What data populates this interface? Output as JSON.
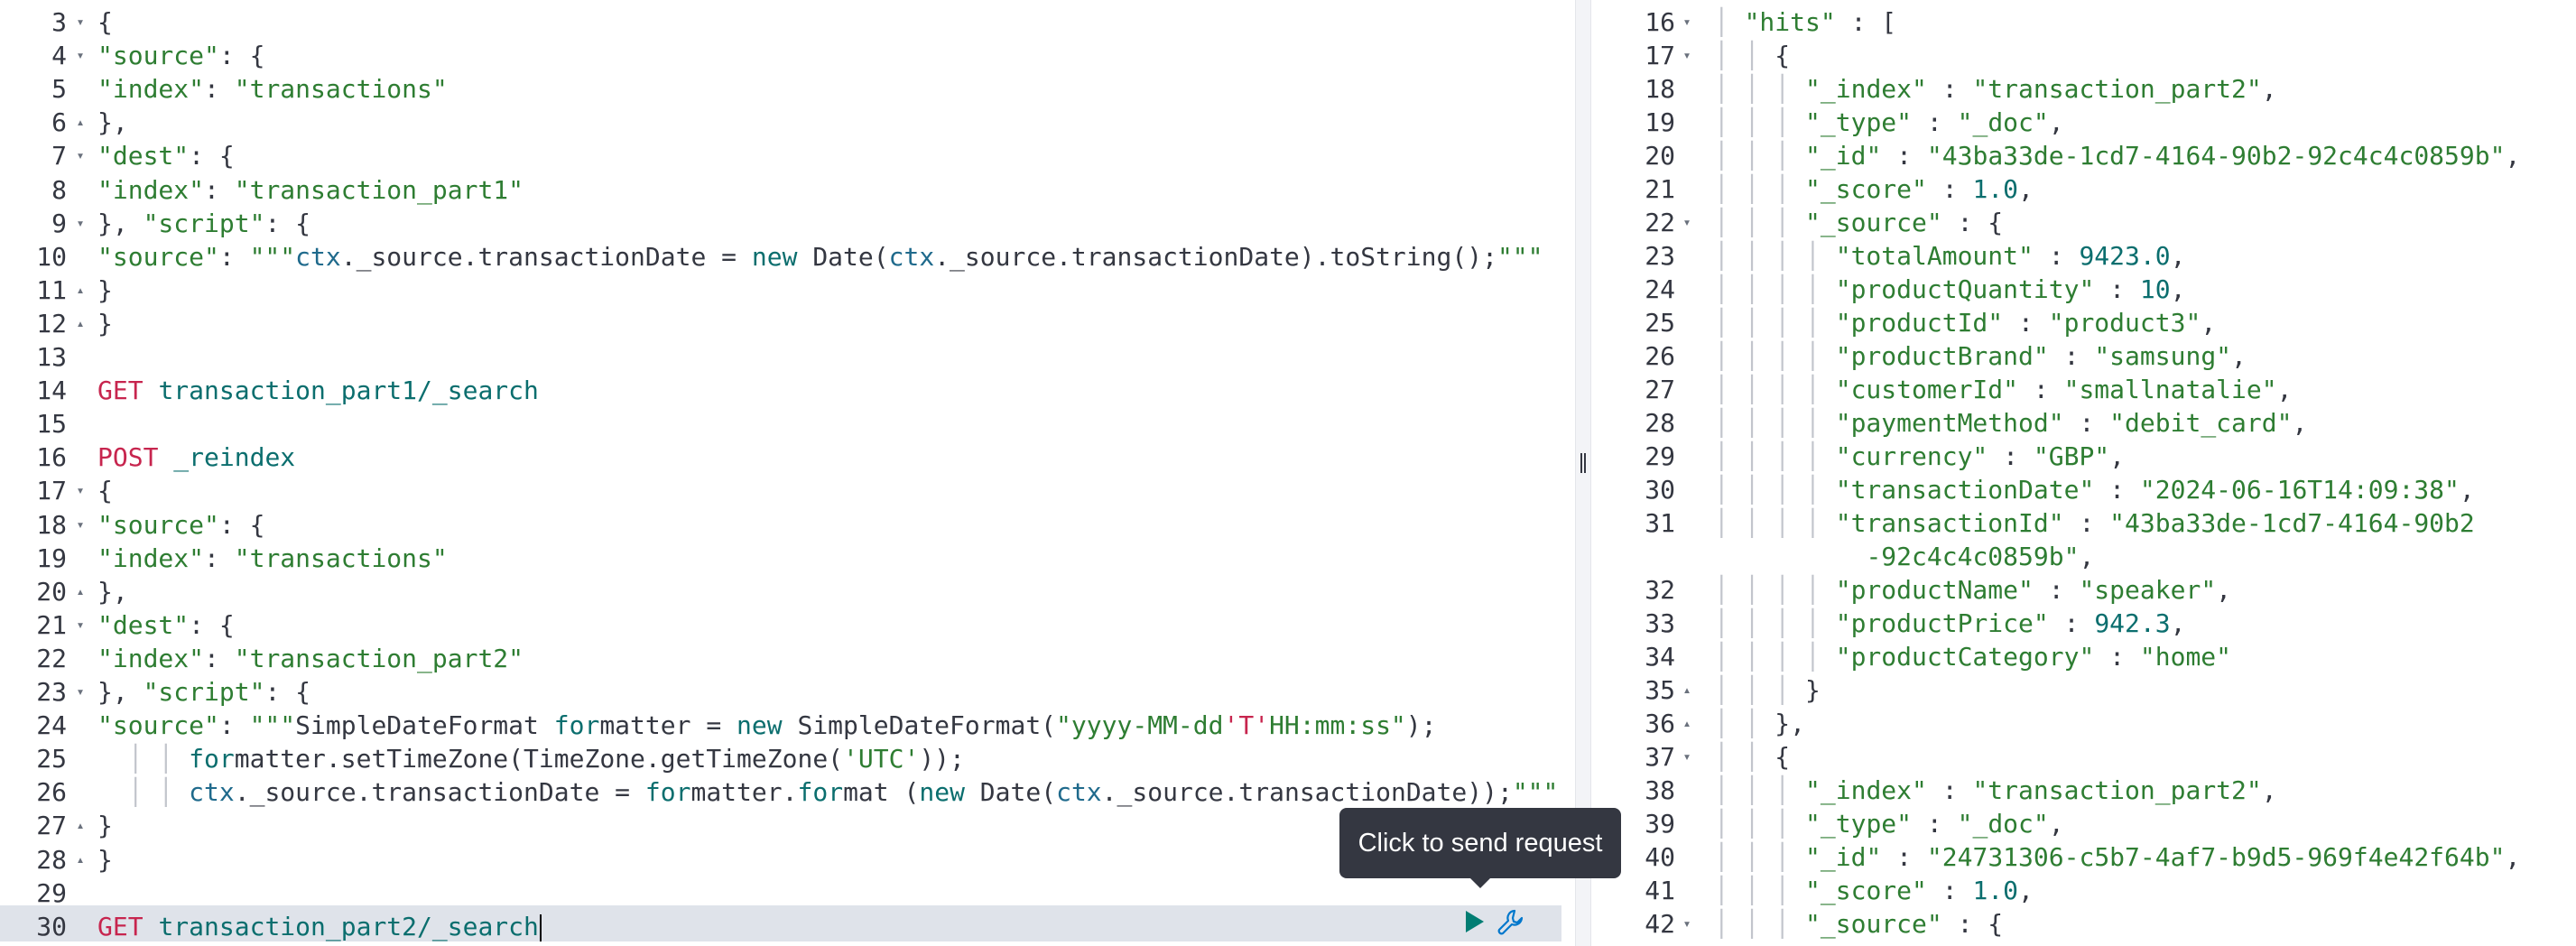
{
  "left_editor": [
    {
      "n": "3",
      "fold": "▾",
      "tokens": [
        [
          "k",
          "{"
        ]
      ]
    },
    {
      "n": "4",
      "fold": "▾",
      "tokens": [
        [
          "s",
          "\"source\""
        ],
        [
          "k",
          ": {"
        ]
      ]
    },
    {
      "n": "5",
      "fold": "",
      "tokens": [
        [
          "s",
          "\"index\""
        ],
        [
          "k",
          ": "
        ],
        [
          "s",
          "\"transactions\""
        ]
      ]
    },
    {
      "n": "6",
      "fold": "▴",
      "tokens": [
        [
          "k",
          "},"
        ]
      ]
    },
    {
      "n": "7",
      "fold": "▾",
      "tokens": [
        [
          "s",
          "\"dest\""
        ],
        [
          "k",
          ": {"
        ]
      ]
    },
    {
      "n": "8",
      "fold": "",
      "tokens": [
        [
          "s",
          "\"index\""
        ],
        [
          "k",
          ": "
        ],
        [
          "s",
          "\"transaction_part1\""
        ]
      ]
    },
    {
      "n": "9",
      "fold": "▾",
      "tokens": [
        [
          "k",
          "}, "
        ],
        [
          "s",
          "\"script\""
        ],
        [
          "k",
          ": {"
        ]
      ]
    },
    {
      "n": "10",
      "fold": "",
      "tokens": [
        [
          "s",
          "\"source\""
        ],
        [
          "k",
          ": "
        ],
        [
          "s",
          "\"\"\""
        ],
        [
          "p",
          "ctx"
        ],
        [
          "k",
          "._source.transactionDate = "
        ],
        [
          "n",
          "new"
        ],
        [
          "k",
          " Date("
        ],
        [
          "p",
          "ctx"
        ],
        [
          "k",
          "._source.transactionDate).toString();"
        ],
        [
          "s",
          "\"\"\""
        ]
      ]
    },
    {
      "n": "11",
      "fold": "▴",
      "tokens": [
        [
          "k",
          "}"
        ]
      ]
    },
    {
      "n": "12",
      "fold": "▴",
      "tokens": [
        [
          "k",
          "}"
        ]
      ]
    },
    {
      "n": "13",
      "fold": "",
      "tokens": []
    },
    {
      "n": "14",
      "fold": "",
      "tokens": [
        [
          "m",
          "GET"
        ],
        [
          "k",
          " "
        ],
        [
          "n",
          "transaction_part1/_search"
        ]
      ]
    },
    {
      "n": "15",
      "fold": "",
      "tokens": []
    },
    {
      "n": "16",
      "fold": "",
      "tokens": [
        [
          "m",
          "POST"
        ],
        [
          "k",
          " "
        ],
        [
          "n",
          "_reindex"
        ]
      ]
    },
    {
      "n": "17",
      "fold": "▾",
      "tokens": [
        [
          "k",
          "{"
        ]
      ]
    },
    {
      "n": "18",
      "fold": "▾",
      "tokens": [
        [
          "s",
          "\"source\""
        ],
        [
          "k",
          ": {"
        ]
      ]
    },
    {
      "n": "19",
      "fold": "",
      "tokens": [
        [
          "s",
          "\"index\""
        ],
        [
          "k",
          ": "
        ],
        [
          "s",
          "\"transactions\""
        ]
      ]
    },
    {
      "n": "20",
      "fold": "▴",
      "tokens": [
        [
          "k",
          "},"
        ]
      ]
    },
    {
      "n": "21",
      "fold": "▾",
      "tokens": [
        [
          "s",
          "\"dest\""
        ],
        [
          "k",
          ": {"
        ]
      ]
    },
    {
      "n": "22",
      "fold": "",
      "tokens": [
        [
          "s",
          "\"index\""
        ],
        [
          "k",
          ": "
        ],
        [
          "s",
          "\"transaction_part2\""
        ]
      ]
    },
    {
      "n": "23",
      "fold": "▾",
      "tokens": [
        [
          "k",
          "}, "
        ],
        [
          "s",
          "\"script\""
        ],
        [
          "k",
          ": {"
        ]
      ]
    },
    {
      "n": "24",
      "fold": "",
      "tokens": [
        [
          "s",
          "\"source\""
        ],
        [
          "k",
          ": "
        ],
        [
          "s",
          "\"\"\""
        ],
        [
          "k",
          "SimpleDateFormat "
        ],
        [
          "n",
          "for"
        ],
        [
          "k",
          "matter = "
        ],
        [
          "n",
          "new"
        ],
        [
          "k",
          " SimpleDateFormat("
        ],
        [
          "s",
          "\"yyyy-MM-dd"
        ],
        [
          "m",
          "'T'"
        ],
        [
          "s",
          "HH:mm:ss\""
        ],
        [
          "k",
          ");"
        ]
      ]
    },
    {
      "n": "25",
      "fold": "",
      "tokens": [
        [
          "g",
          "  │ │ "
        ],
        [
          "n",
          "for"
        ],
        [
          "k",
          "matter.setTimeZone(TimeZone.getTimeZone("
        ],
        [
          "s",
          "'UTC'"
        ],
        [
          "k",
          "));"
        ]
      ]
    },
    {
      "n": "26",
      "fold": "",
      "tokens": [
        [
          "g",
          "  │ │ "
        ],
        [
          "p",
          "ctx"
        ],
        [
          "k",
          "._source.transactionDate = "
        ],
        [
          "n",
          "for"
        ],
        [
          "k",
          "matter."
        ],
        [
          "n",
          "for"
        ],
        [
          "k",
          "mat ("
        ],
        [
          "n",
          "new"
        ],
        [
          "k",
          " Date("
        ],
        [
          "p",
          "ctx"
        ],
        [
          "k",
          "._source.transactionDate));"
        ],
        [
          "s",
          "\"\"\""
        ]
      ]
    },
    {
      "n": "27",
      "fold": "▴",
      "tokens": [
        [
          "k",
          "}"
        ]
      ]
    },
    {
      "n": "28",
      "fold": "▴",
      "tokens": [
        [
          "k",
          "}"
        ]
      ]
    },
    {
      "n": "29",
      "fold": "",
      "tokens": []
    },
    {
      "n": "30",
      "fold": "",
      "tokens": [
        [
          "m",
          "GET"
        ],
        [
          "k",
          " "
        ],
        [
          "n",
          "transaction_part2/_search"
        ]
      ]
    }
  ],
  "right_output": [
    {
      "n": "16",
      "fold": "▾",
      "tokens": [
        [
          "g",
          " │ "
        ],
        [
          "s",
          "\"hits\""
        ],
        [
          "k",
          " : ["
        ]
      ]
    },
    {
      "n": "17",
      "fold": "▾",
      "tokens": [
        [
          "g",
          " │ │ "
        ],
        [
          "k",
          "{"
        ]
      ]
    },
    {
      "n": "18",
      "fold": "",
      "tokens": [
        [
          "g",
          " │ │ │ "
        ],
        [
          "s",
          "\"_index\""
        ],
        [
          "k",
          " : "
        ],
        [
          "s",
          "\"transaction_part2\""
        ],
        [
          "k",
          ","
        ]
      ]
    },
    {
      "n": "19",
      "fold": "",
      "tokens": [
        [
          "g",
          " │ │ │ "
        ],
        [
          "s",
          "\"_type\""
        ],
        [
          "k",
          " : "
        ],
        [
          "s",
          "\"_doc\""
        ],
        [
          "k",
          ","
        ]
      ]
    },
    {
      "n": "20",
      "fold": "",
      "tokens": [
        [
          "g",
          " │ │ │ "
        ],
        [
          "s",
          "\"_id\""
        ],
        [
          "k",
          " : "
        ],
        [
          "s",
          "\"43ba33de-1cd7-4164-90b2-92c4c4c0859b\""
        ],
        [
          "k",
          ","
        ]
      ]
    },
    {
      "n": "21",
      "fold": "",
      "tokens": [
        [
          "g",
          " │ │ │ "
        ],
        [
          "s",
          "\"_score\""
        ],
        [
          "k",
          " : "
        ],
        [
          "n",
          "1.0"
        ],
        [
          "k",
          ","
        ]
      ]
    },
    {
      "n": "22",
      "fold": "▾",
      "tokens": [
        [
          "g",
          " │ │ │ "
        ],
        [
          "s",
          "\"_source\""
        ],
        [
          "k",
          " : {"
        ]
      ]
    },
    {
      "n": "23",
      "fold": "",
      "tokens": [
        [
          "g",
          " │ │ │ │ "
        ],
        [
          "s",
          "\"totalAmount\""
        ],
        [
          "k",
          " : "
        ],
        [
          "n",
          "9423.0"
        ],
        [
          "k",
          ","
        ]
      ]
    },
    {
      "n": "24",
      "fold": "",
      "tokens": [
        [
          "g",
          " │ │ │ │ "
        ],
        [
          "s",
          "\"productQuantity\""
        ],
        [
          "k",
          " : "
        ],
        [
          "n",
          "10"
        ],
        [
          "k",
          ","
        ]
      ]
    },
    {
      "n": "25",
      "fold": "",
      "tokens": [
        [
          "g",
          " │ │ │ │ "
        ],
        [
          "s",
          "\"productId\""
        ],
        [
          "k",
          " : "
        ],
        [
          "s",
          "\"product3\""
        ],
        [
          "k",
          ","
        ]
      ]
    },
    {
      "n": "26",
      "fold": "",
      "tokens": [
        [
          "g",
          " │ │ │ │ "
        ],
        [
          "s",
          "\"productBrand\""
        ],
        [
          "k",
          " : "
        ],
        [
          "s",
          "\"samsung\""
        ],
        [
          "k",
          ","
        ]
      ]
    },
    {
      "n": "27",
      "fold": "",
      "tokens": [
        [
          "g",
          " │ │ │ │ "
        ],
        [
          "s",
          "\"customerId\""
        ],
        [
          "k",
          " : "
        ],
        [
          "s",
          "\"smallnatalie\""
        ],
        [
          "k",
          ","
        ]
      ]
    },
    {
      "n": "28",
      "fold": "",
      "tokens": [
        [
          "g",
          " │ │ │ │ "
        ],
        [
          "s",
          "\"paymentMethod\""
        ],
        [
          "k",
          " : "
        ],
        [
          "s",
          "\"debit_card\""
        ],
        [
          "k",
          ","
        ]
      ]
    },
    {
      "n": "29",
      "fold": "",
      "tokens": [
        [
          "g",
          " │ │ │ │ "
        ],
        [
          "s",
          "\"currency\""
        ],
        [
          "k",
          " : "
        ],
        [
          "s",
          "\"GBP\""
        ],
        [
          "k",
          ","
        ]
      ]
    },
    {
      "n": "30",
      "fold": "",
      "tokens": [
        [
          "g",
          " │ │ │ │ "
        ],
        [
          "s",
          "\"transactionDate\""
        ],
        [
          "k",
          " : "
        ],
        [
          "s",
          "\"2024-06-16T14:09:38\""
        ],
        [
          "k",
          ","
        ]
      ]
    },
    {
      "n": "31",
      "fold": "",
      "tokens": [
        [
          "g",
          " │ │ │ │ "
        ],
        [
          "s",
          "\"transactionId\""
        ],
        [
          "k",
          " : "
        ],
        [
          "s",
          "\"43ba33de-1cd7-4164-90b2"
        ]
      ]
    },
    {
      "n": "",
      "fold": "",
      "tokens": [
        [
          "k",
          "           "
        ],
        [
          "s",
          "-92c4c4c0859b\""
        ],
        [
          "k",
          ","
        ]
      ]
    },
    {
      "n": "32",
      "fold": "",
      "tokens": [
        [
          "g",
          " │ │ │ │ "
        ],
        [
          "s",
          "\"productName\""
        ],
        [
          "k",
          " : "
        ],
        [
          "s",
          "\"speaker\""
        ],
        [
          "k",
          ","
        ]
      ]
    },
    {
      "n": "33",
      "fold": "",
      "tokens": [
        [
          "g",
          " │ │ │ │ "
        ],
        [
          "s",
          "\"productPrice\""
        ],
        [
          "k",
          " : "
        ],
        [
          "n",
          "942.3"
        ],
        [
          "k",
          ","
        ]
      ]
    },
    {
      "n": "34",
      "fold": "",
      "tokens": [
        [
          "g",
          " │ │ │ │ "
        ],
        [
          "s",
          "\"productCategory\""
        ],
        [
          "k",
          " : "
        ],
        [
          "s",
          "\"home\""
        ]
      ]
    },
    {
      "n": "35",
      "fold": "▴",
      "tokens": [
        [
          "g",
          " │ │ │ "
        ],
        [
          "k",
          "}"
        ]
      ]
    },
    {
      "n": "36",
      "fold": "▴",
      "tokens": [
        [
          "g",
          " │ │ "
        ],
        [
          "k",
          "},"
        ]
      ]
    },
    {
      "n": "37",
      "fold": "▾",
      "tokens": [
        [
          "g",
          " │ │ "
        ],
        [
          "k",
          "{"
        ]
      ]
    },
    {
      "n": "38",
      "fold": "",
      "tokens": [
        [
          "g",
          " │ │ │ "
        ],
        [
          "s",
          "\"_index\""
        ],
        [
          "k",
          " : "
        ],
        [
          "s",
          "\"transaction_part2\""
        ],
        [
          "k",
          ","
        ]
      ]
    },
    {
      "n": "39",
      "fold": "",
      "tokens": [
        [
          "g",
          " │ │ │ "
        ],
        [
          "s",
          "\"_type\""
        ],
        [
          "k",
          " : "
        ],
        [
          "s",
          "\"_doc\""
        ],
        [
          "k",
          ","
        ]
      ]
    },
    {
      "n": "40",
      "fold": "",
      "tokens": [
        [
          "g",
          " │ │ │ "
        ],
        [
          "s",
          "\"_id\""
        ],
        [
          "k",
          " : "
        ],
        [
          "s",
          "\"24731306-c5b7-4af7-b9d5-969f4e42f64b\""
        ],
        [
          "k",
          ","
        ]
      ]
    },
    {
      "n": "41",
      "fold": "",
      "tokens": [
        [
          "g",
          " │ │ │ "
        ],
        [
          "s",
          "\"_score\""
        ],
        [
          "k",
          " : "
        ],
        [
          "n",
          "1.0"
        ],
        [
          "k",
          ","
        ]
      ]
    },
    {
      "n": "42",
      "fold": "▾",
      "tokens": [
        [
          "g",
          " │ │ │ "
        ],
        [
          "s",
          "\"_source\""
        ],
        [
          "k",
          " : {"
        ]
      ]
    }
  ],
  "tooltip": {
    "text": "Click to send request"
  },
  "icons": {
    "run": "play-icon",
    "settings": "wrench-icon"
  },
  "colors": {
    "string": "#2e7d32",
    "method": "#c7254e",
    "keyword": "#0b6e6e",
    "text": "#343741"
  }
}
